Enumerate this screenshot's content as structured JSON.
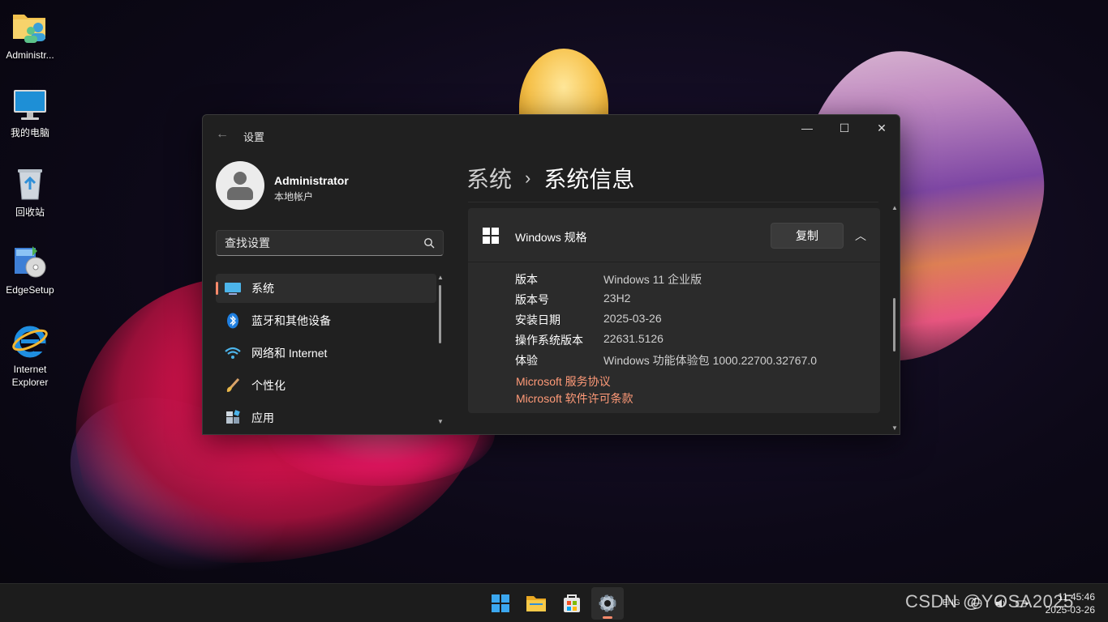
{
  "desktop": {
    "icons": [
      {
        "label": "Administr..."
      },
      {
        "label": "我的电脑"
      },
      {
        "label": "回收站"
      },
      {
        "label": "EdgeSetup"
      },
      {
        "label": "Internet\nExplorer"
      }
    ]
  },
  "window": {
    "title": "设置",
    "controls": {
      "minimize": "—",
      "maximize": "☐",
      "close": "✕"
    }
  },
  "profile": {
    "name": "Administrator",
    "type": "本地帐户"
  },
  "search": {
    "placeholder": "查找设置"
  },
  "nav": {
    "items": [
      {
        "label": "系统",
        "active": true
      },
      {
        "label": "蓝牙和其他设备"
      },
      {
        "label": "网络和 Internet"
      },
      {
        "label": "个性化"
      },
      {
        "label": "应用"
      }
    ]
  },
  "breadcrumb": {
    "parent": "系统",
    "separator": "›",
    "current": "系统信息"
  },
  "spec_card": {
    "title": "Windows 规格",
    "copy_label": "复制",
    "rows": [
      {
        "key": "版本",
        "value": "Windows 11 企业版"
      },
      {
        "key": "版本号",
        "value": "23H2"
      },
      {
        "key": "安装日期",
        "value": "2025-03-26"
      },
      {
        "key": "操作系统版本",
        "value": "22631.5126"
      },
      {
        "key": "体验",
        "value": "Windows 功能体验包 1000.22700.32767.0"
      }
    ],
    "links": [
      {
        "label": "Microsoft 服务协议"
      },
      {
        "label": "Microsoft 软件许可条款"
      }
    ]
  },
  "taskbar": {
    "lang": "ENG",
    "time": "11:45:46",
    "date": "2025-03-26"
  },
  "watermark": "CSDN @YOSA2025",
  "colors": {
    "accent": "#ff8a6b",
    "link": "#ff9a78",
    "window_bg": "#202020",
    "card_bg": "#2b2b2b"
  }
}
